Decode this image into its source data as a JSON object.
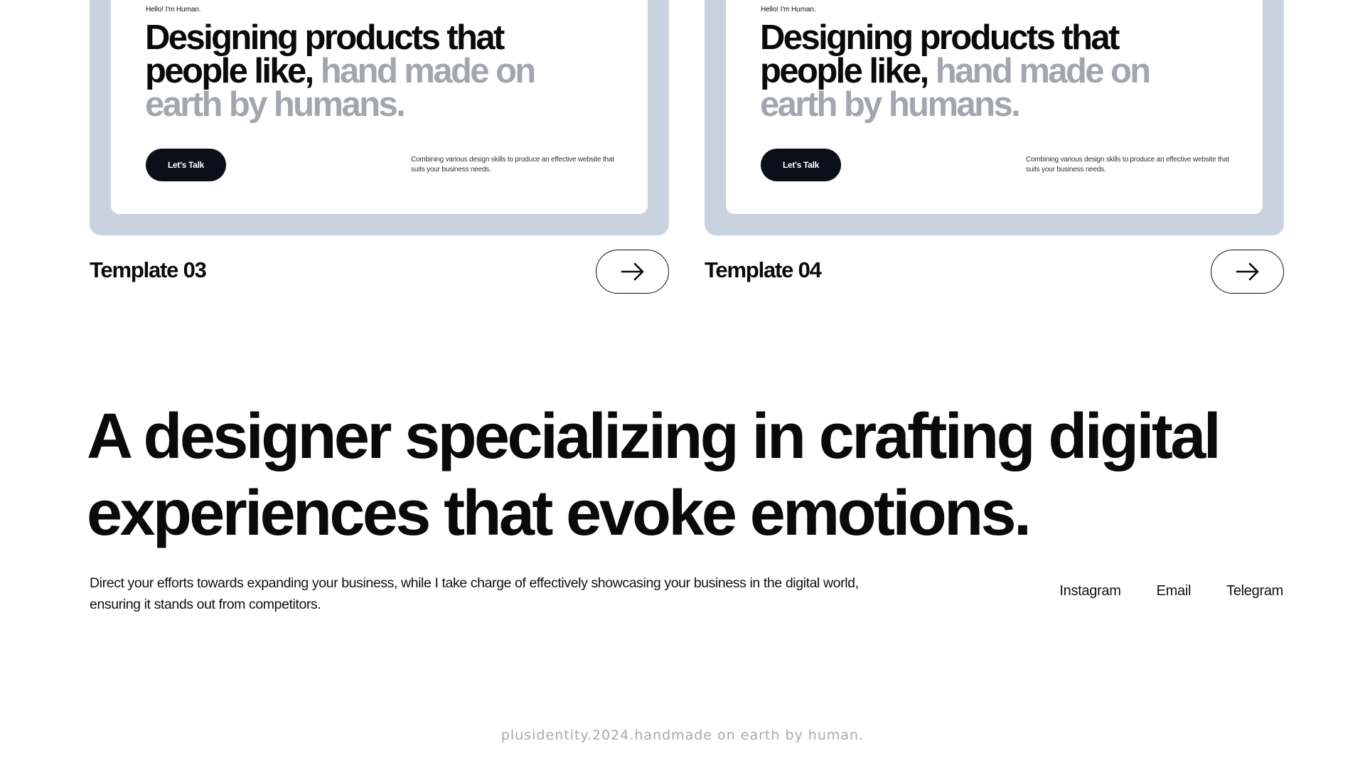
{
  "templates": [
    {
      "preview": {
        "hello": "Hello! I'm Human.",
        "headline_dark": "Designing products that people like,",
        "headline_muted": "hand made on earth by humans.",
        "button_label": "Let's Talk",
        "description": "Combining various design skills to produce an effective website that suits your business needs."
      },
      "title": "Template 03"
    },
    {
      "preview": {
        "hello": "Hello! I'm Human.",
        "headline_dark": "Designing products that people like,",
        "headline_muted": "hand made on earth by humans.",
        "button_label": "Let's Talk",
        "description": "Combining various design skills to produce an effective website that suits your business needs."
      },
      "title": "Template 04"
    }
  ],
  "hero": {
    "statement": "A designer specializing in crafting digital experiences that evoke emotions.",
    "description": "Direct your efforts towards expanding your business, while I take charge of effectively showcasing your business in the digital world, ensuring it stands out from competitors."
  },
  "social_links": [
    "Instagram",
    "Email",
    "Telegram"
  ],
  "footer": {
    "text": "plusidentity.2024.handmade on earth by human."
  },
  "icons": {
    "open_template": "arrow-right-icon"
  },
  "colors": {
    "card_frame": "#c9d2df",
    "button_dark": "#0b0f19",
    "muted_text": "#a3a6ad",
    "footer_text": "#a5a8ae"
  }
}
